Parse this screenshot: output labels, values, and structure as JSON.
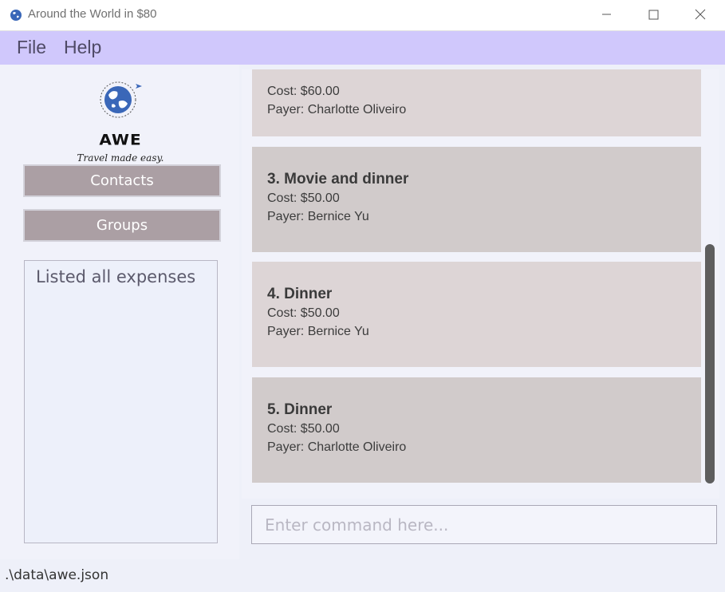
{
  "window": {
    "title": "Around the World in $80",
    "app_icon": "globe-icon",
    "controls": [
      "minimize-icon",
      "maximize-icon",
      "close-icon"
    ]
  },
  "menu": {
    "items": [
      {
        "label": "File"
      },
      {
        "label": "Help"
      }
    ]
  },
  "sidebar": {
    "logo_word": "AWE",
    "logo_tagline": "Travel made easy.",
    "buttons": [
      {
        "label": "Contacts"
      },
      {
        "label": "Groups"
      }
    ],
    "result_message": "Listed all expenses"
  },
  "expenses": [
    {
      "title": "",
      "cost": "Cost: $60.00",
      "payer": "Payer: Charlotte Oliveiro"
    },
    {
      "title": "3. Movie and dinner",
      "cost": "Cost: $50.00",
      "payer": "Payer: Bernice Yu"
    },
    {
      "title": "4. Dinner",
      "cost": "Cost: $50.00",
      "payer": "Payer: Bernice Yu"
    },
    {
      "title": "5. Dinner",
      "cost": "Cost: $50.00",
      "payer": "Payer: Charlotte Oliveiro"
    }
  ],
  "command": {
    "placeholder": "Enter command here...",
    "value": ""
  },
  "status": {
    "file_path": ".\\data\\awe.json"
  },
  "colors": {
    "menubar": "#d0c8fc",
    "nav_button": "#ab9fa4",
    "card_light": "#ddd5d6",
    "card_dark": "#d1cbcb"
  }
}
